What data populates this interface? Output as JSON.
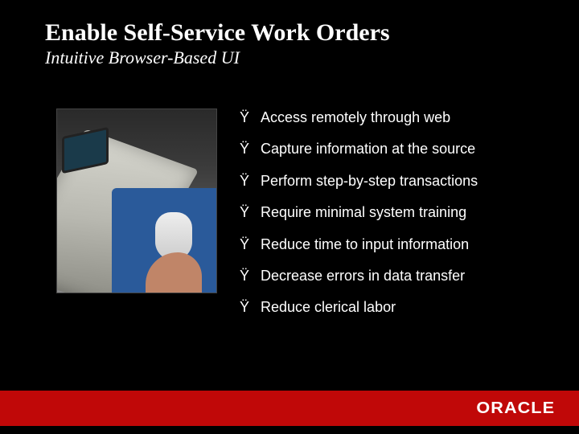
{
  "title": "Enable Self-Service Work Orders",
  "subtitle": "Intuitive Browser-Based UI",
  "bullet_char": "Ÿ",
  "bullets": [
    "Access remotely through web",
    "Capture information at the source",
    "Perform step-by-step transactions",
    "Require minimal system training",
    "Reduce time to input information",
    "Decrease errors in data transfer",
    "Reduce clerical labor"
  ],
  "logo": "ORACLE"
}
